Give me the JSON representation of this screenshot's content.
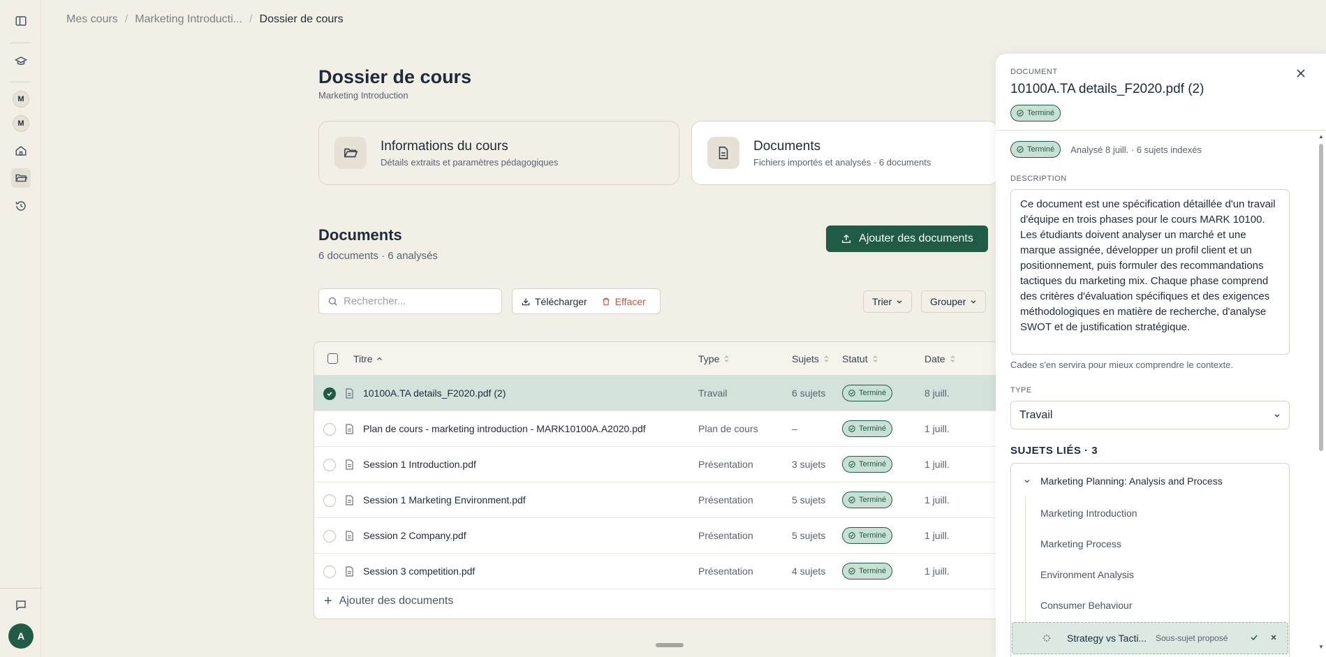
{
  "breadcrumb": {
    "items": [
      "Mes cours",
      "Marketing Introducti...",
      "Dossier de cours"
    ]
  },
  "rail": {
    "badges": [
      "M",
      "M"
    ],
    "avatar": "A"
  },
  "page": {
    "title": "Dossier de cours",
    "subtitle": "Marketing Introduction"
  },
  "cards": [
    {
      "title": "Informations du cours",
      "subtitle": "Détails extraits et paramètres pédagogiques",
      "icon": "folder-open-icon"
    },
    {
      "title": "Documents",
      "subtitle": "Fichiers importés et analysés · 6 documents",
      "icon": "file-text-icon"
    }
  ],
  "documents": {
    "heading": "Documents",
    "count": "6 documents · 6 analysés",
    "add_button": "Ajouter des documents",
    "search_placeholder": "Rechercher...",
    "download_label": "Télécharger",
    "delete_label": "Effacer",
    "sort_label": "Trier",
    "group_label": "Grouper",
    "add_row_label": "Ajouter des documents"
  },
  "table": {
    "columns": {
      "title": "Titre",
      "type": "Type",
      "subjects": "Sujets",
      "status": "Statut",
      "date": "Date"
    },
    "rows": [
      {
        "name": "10100A.TA details_F2020.pdf (2)",
        "type": "Travail",
        "subjects": "6 sujets",
        "status": "Terminé",
        "date": "8 juill.",
        "selected": true
      },
      {
        "name": "Plan de cours - marketing introduction - MARK10100A.A2020.pdf",
        "type": "Plan de cours",
        "subjects": "–",
        "status": "Terminé",
        "date": "1 juill.",
        "selected": false
      },
      {
        "name": "Session 1 Introduction.pdf",
        "type": "Présentation",
        "subjects": "3 sujets",
        "status": "Terminé",
        "date": "1 juill.",
        "selected": false
      },
      {
        "name": "Session 1 Marketing Environment.pdf",
        "type": "Présentation",
        "subjects": "5 sujets",
        "status": "Terminé",
        "date": "1 juill.",
        "selected": false
      },
      {
        "name": "Session 2 Company.pdf",
        "type": "Présentation",
        "subjects": "5 sujets",
        "status": "Terminé",
        "date": "1 juill.",
        "selected": false
      },
      {
        "name": "Session 3 competition.pdf",
        "type": "Présentation",
        "subjects": "4 sujets",
        "status": "Terminé",
        "date": "1 juill.",
        "selected": false
      }
    ]
  },
  "panel": {
    "label": "DOCUMENT",
    "filename": "10100A.TA details_F2020.pdf (2)",
    "status": "Terminé",
    "meta": "Analysé 8 juill. · 6 sujets indexés",
    "description_label": "DESCRIPTION",
    "description": "Ce document est une spécification détaillée d'un travail d'équipe en trois phases pour le cours MARK 10100. Les étudiants doivent analyser un marché et une marque assignée, développer un profil client et un positionnement, puis formuler des recommandations tactiques du marketing mix. Chaque phase comprend des critères d'évaluation spécifiques et des exigences méthodologiques en matière de recherche, d'analyse SWOT et de justification stratégique.",
    "hint": "Cadee s'en servira pour mieux comprendre le contexte.",
    "type_label": "TYPE",
    "type_value": "Travail",
    "subjects_heading": "SUJETS LIÉS · 3",
    "parent_subject": "Marketing Planning: Analysis and Process",
    "children": [
      "Marketing Introduction",
      "Marketing Process",
      "Environment Analysis",
      "Consumer Behaviour"
    ],
    "proposed": {
      "name": "Strategy vs Tacti...",
      "tag": "Sous-sujet proposé"
    }
  },
  "colors": {
    "accent": "#1f5b45",
    "background": "#f2efe6",
    "danger": "#c2563f"
  }
}
